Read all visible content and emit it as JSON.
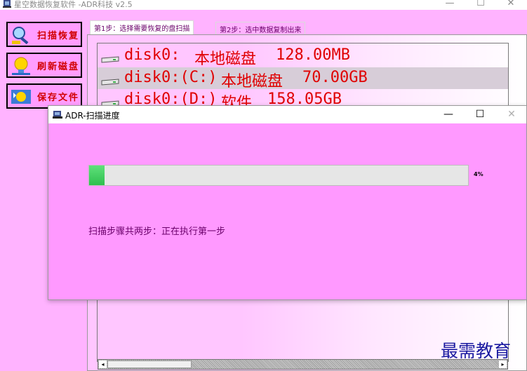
{
  "main_window": {
    "title": "星空数据恢复软件  -ADR科技 v2.5",
    "icon": "app-logo-icon",
    "controls": [
      "—",
      "☐",
      "✕"
    ]
  },
  "sidebar": {
    "buttons": [
      {
        "label": "扫描恢复",
        "icon": "magnifier-icon"
      },
      {
        "label": "刷新磁盘",
        "icon": "bulb-icon"
      },
      {
        "label": "保存文件",
        "icon": "save-globe-icon"
      }
    ]
  },
  "tabs": [
    {
      "label": "第1步：选择需要恢复的盘扫描",
      "active": true
    },
    {
      "label": "第2步：选中数据复制出来",
      "active": false
    }
  ],
  "disks": [
    {
      "name": "disk0:",
      "type": "本地磁盘",
      "size": "128.00MB"
    },
    {
      "name": "disk0:(C:)",
      "type": "本地磁盘",
      "size": "70.00GB"
    },
    {
      "name": "disk0:(D:)",
      "type": "软件",
      "size": "158.05GB"
    }
  ],
  "scrollbar": {
    "left_arrow": "◂",
    "right_arrow": "▸"
  },
  "dialog": {
    "title": "ADR-扫描进度",
    "icon": "app-logo-icon",
    "controls": [
      "—",
      "☐",
      "✕"
    ],
    "progress_value": 4,
    "progress_label": "4%",
    "status": "扫描步骤共两步：正在执行第一步"
  },
  "watermark": "最需教育",
  "colors": {
    "background": "#ffb3ff",
    "disk_text": "#e00000",
    "progress_fill": "#2fbf4f",
    "dialog_background": "#ff99ff"
  }
}
